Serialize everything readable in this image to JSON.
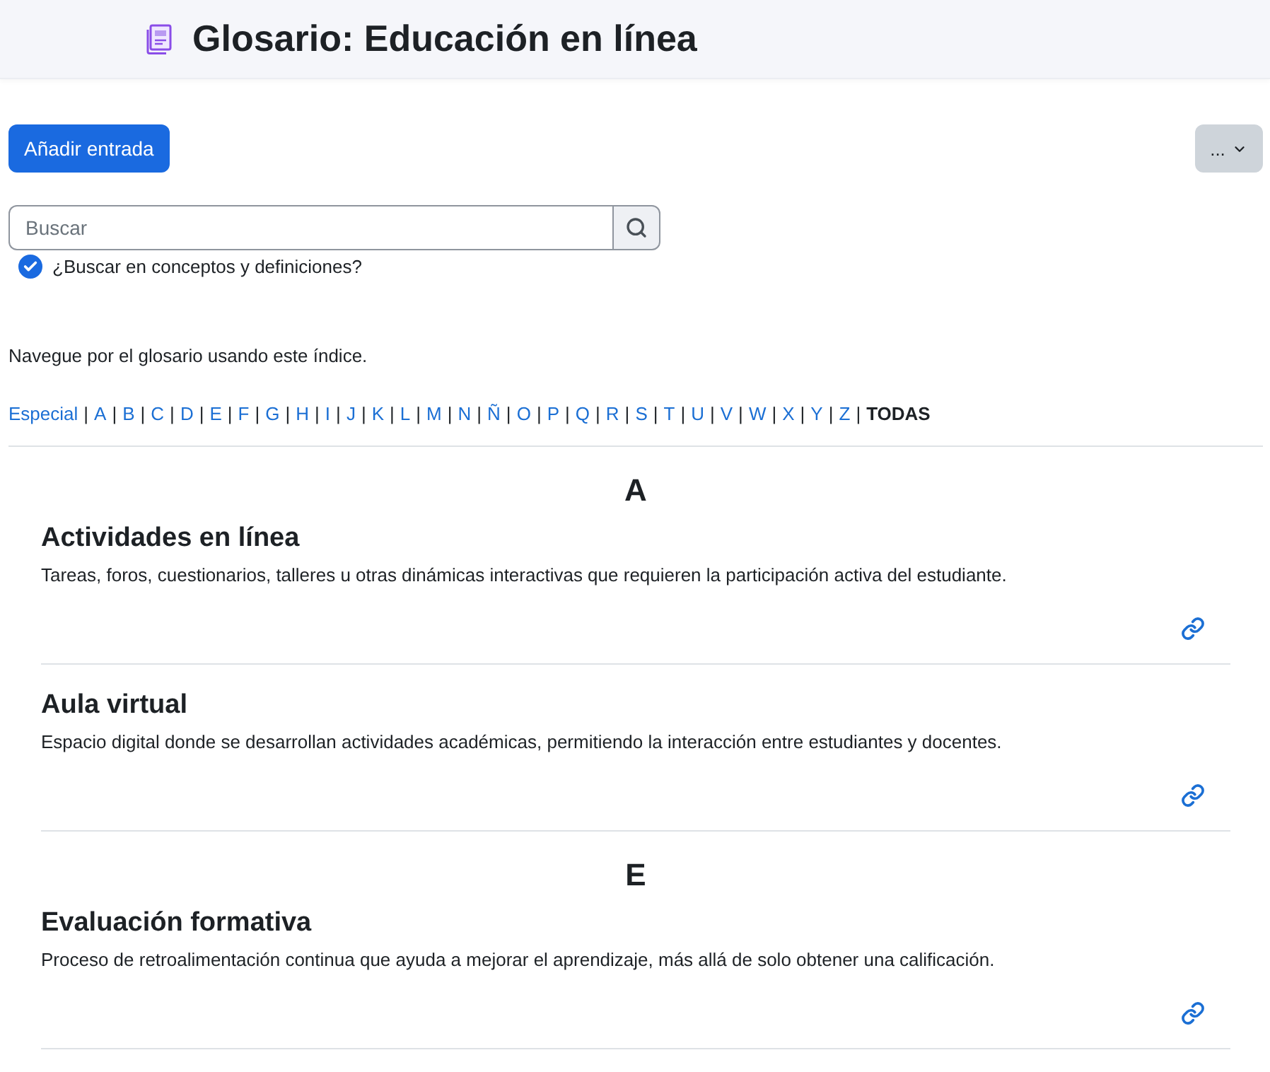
{
  "header": {
    "title": "Glosario: Educación en línea"
  },
  "actions": {
    "add_button": "Añadir entrada",
    "menu_button": "..."
  },
  "search": {
    "placeholder": "Buscar",
    "full_search": {
      "label": "¿Buscar en conceptos y definiciones?",
      "checked": true
    }
  },
  "index": {
    "intro": "Navegue por el glosario usando este índice.",
    "separator": "|",
    "letters": [
      {
        "label": "Especial",
        "selected": false
      },
      {
        "label": "A",
        "selected": false
      },
      {
        "label": "B",
        "selected": false
      },
      {
        "label": "C",
        "selected": false
      },
      {
        "label": "D",
        "selected": false
      },
      {
        "label": "E",
        "selected": false
      },
      {
        "label": "F",
        "selected": false
      },
      {
        "label": "G",
        "selected": false
      },
      {
        "label": "H",
        "selected": false
      },
      {
        "label": "I",
        "selected": false
      },
      {
        "label": "J",
        "selected": false
      },
      {
        "label": "K",
        "selected": false
      },
      {
        "label": "L",
        "selected": false
      },
      {
        "label": "M",
        "selected": false
      },
      {
        "label": "N",
        "selected": false
      },
      {
        "label": "Ñ",
        "selected": false
      },
      {
        "label": "O",
        "selected": false
      },
      {
        "label": "P",
        "selected": false
      },
      {
        "label": "Q",
        "selected": false
      },
      {
        "label": "R",
        "selected": false
      },
      {
        "label": "S",
        "selected": false
      },
      {
        "label": "T",
        "selected": false
      },
      {
        "label": "U",
        "selected": false
      },
      {
        "label": "V",
        "selected": false
      },
      {
        "label": "W",
        "selected": false
      },
      {
        "label": "X",
        "selected": false
      },
      {
        "label": "Y",
        "selected": false
      },
      {
        "label": "Z",
        "selected": false
      },
      {
        "label": "TODAS",
        "selected": true
      }
    ]
  },
  "groups": [
    {
      "letter": "A",
      "entries": [
        {
          "concept": "Actividades en línea",
          "definition": "Tareas, foros, cuestionarios, talleres u otras dinámicas interactivas que requieren la participación activa del estudiante."
        },
        {
          "concept": "Aula virtual",
          "definition": "Espacio digital donde se desarrollan actividades académicas, permitiendo la interacción entre estudiantes y docentes."
        }
      ]
    },
    {
      "letter": "E",
      "entries": [
        {
          "concept": "Evaluación formativa",
          "definition": "Proceso de retroalimentación continua que ayuda a mejorar el aprendizaje, más allá de solo obtener una calificación."
        }
      ]
    }
  ]
}
